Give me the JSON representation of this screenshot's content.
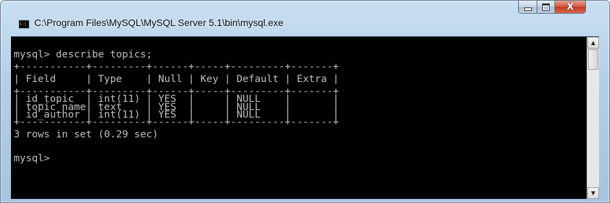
{
  "window": {
    "title": "C:\\Program Files\\MySQL\\MySQL Server 5.1\\bin\\mysql.exe",
    "icon_text": "C:\\",
    "minimize_label": "",
    "close_label": "X"
  },
  "console": {
    "lines": [
      "",
      "mysql> describe topics;",
      "+-----------+---------+------+-----+---------+-------+",
      "| Field     | Type    | Null | Key | Default | Extra |",
      "+-----------+---------+------+-----+---------+-------+",
      "| id_topic  | int(11) | YES  |     | NULL    |       |",
      "| topic_name| text    | YES  |     | NULL    |       |",
      "| id_author | int(11) | YES  |     | NULL    |       |",
      "+-----------+---------+------+-----+---------+-------+",
      "3 rows in set (0.29 sec)",
      "",
      "mysql> "
    ]
  },
  "colors": {
    "console_bg": "#000000",
    "console_fg": "#c0c0c0",
    "close_button": "#c8482c"
  }
}
